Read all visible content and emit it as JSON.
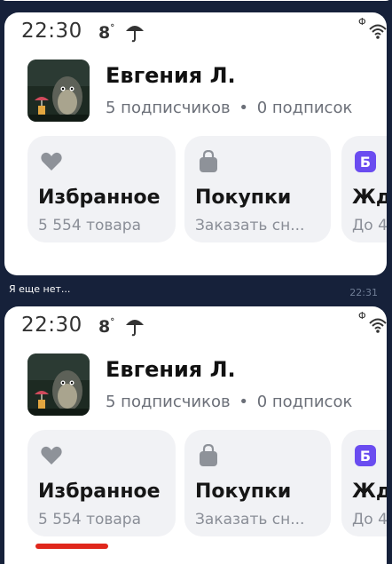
{
  "status": {
    "time": "22:30",
    "temperature": "8",
    "degree": "°",
    "weather_icon": "umbrella-icon",
    "sim": "Φ",
    "wifi_icon": "wifi-icon"
  },
  "profile": {
    "name": "Евгения Л.",
    "subscribers": "5 подписчиков",
    "separator": "•",
    "subscriptions": "0 подписок"
  },
  "cards": [
    {
      "icon": "heart-icon",
      "title": "Избранное",
      "subtitle": "5 554 товара"
    },
    {
      "icon": "bag-icon",
      "title": "Покупки",
      "subtitle": "Заказать сн..."
    },
    {
      "icon": "b-badge-icon",
      "badge_letter": "Б",
      "title": "Жд",
      "subtitle": "До 4"
    }
  ],
  "message": {
    "text": "Я еще нет...",
    "time": "22:31"
  },
  "colors": {
    "chat_bg": "#16213a",
    "card_bg": "#f1f2f5",
    "badge": "#6a4cf0",
    "icon_gray": "#8e9299",
    "underline": "#e0271c"
  }
}
